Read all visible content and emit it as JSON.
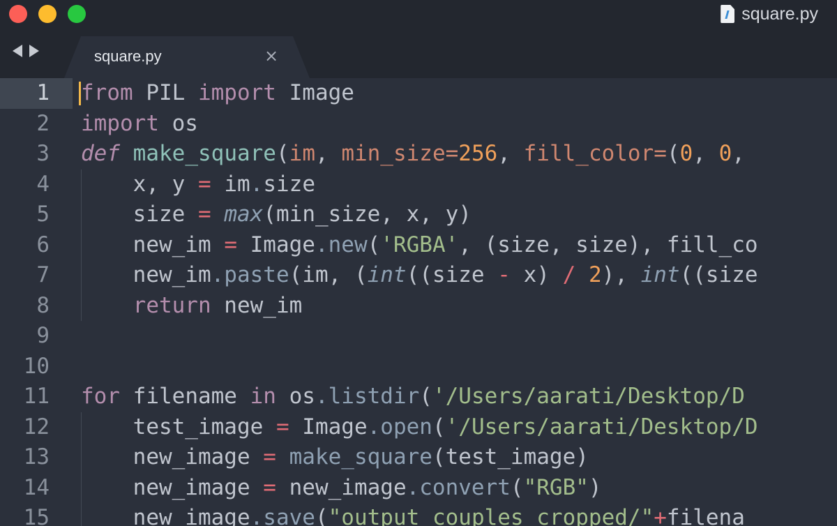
{
  "window": {
    "title": "square.py",
    "colors": {
      "close": "#fc5f57",
      "minimize": "#fdbc2e",
      "zoom": "#28c840",
      "background": "#2b303b",
      "cursor": "#f4b94b"
    }
  },
  "tabs": [
    {
      "label": "square.py",
      "close_glyph": "×",
      "active": true
    }
  ],
  "editor": {
    "active_line": 1,
    "line_numbers": [
      "1",
      "2",
      "3",
      "4",
      "5",
      "6",
      "7",
      "8",
      "9",
      "10",
      "11",
      "12",
      "13",
      "14",
      "15"
    ],
    "lines": [
      "from PIL import Image",
      "import os",
      "def make_square(im, min_size=256, fill_color=(0, 0,",
      "    x, y = im.size",
      "    size = max(min_size, x, y)",
      "    new_im = Image.new('RGBA', (size, size), fill_co",
      "    new_im.paste(im, (int((size - x) / 2), int((size",
      "    return new_im",
      "",
      "",
      "for filename in os.listdir('/Users/aarati/Desktop/D",
      "    test_image = Image.open('/Users/aarati/Desktop/D",
      "    new_image = make_square(test_image)",
      "    new_image = new_image.convert(\"RGB\")",
      "    new_image.save(\"output_couples_cropped/\"+filena"
    ]
  }
}
